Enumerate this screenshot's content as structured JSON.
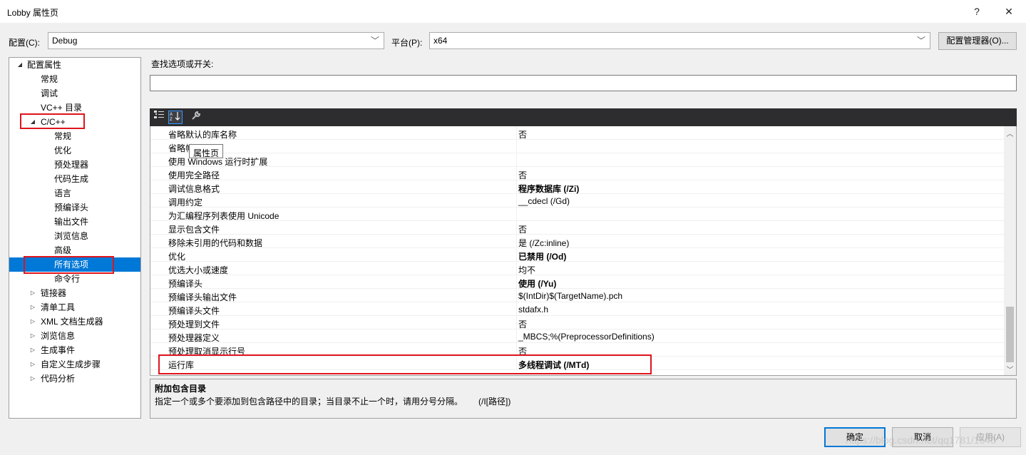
{
  "window": {
    "title": "Lobby 属性页",
    "help_label": "?",
    "close_label": "✕"
  },
  "config": {
    "label": "配置(C):",
    "value": "Debug",
    "platform_label": "平台(P):",
    "platform_value": "x64",
    "manager_button": "配置管理器(O)..."
  },
  "tree": {
    "items": [
      {
        "label": "配置属性",
        "expander": "◢"
      },
      {
        "label": "常规",
        "expander": ""
      },
      {
        "label": "调试",
        "expander": ""
      },
      {
        "label": "VC++ 目录",
        "expander": ""
      },
      {
        "label": "C/C++",
        "expander": "◢"
      },
      {
        "label": "常规",
        "expander": ""
      },
      {
        "label": "优化",
        "expander": ""
      },
      {
        "label": "预处理器",
        "expander": ""
      },
      {
        "label": "代码生成",
        "expander": ""
      },
      {
        "label": "语言",
        "expander": ""
      },
      {
        "label": "预编译头",
        "expander": ""
      },
      {
        "label": "输出文件",
        "expander": ""
      },
      {
        "label": "浏览信息",
        "expander": ""
      },
      {
        "label": "高级",
        "expander": ""
      },
      {
        "label": "所有选项",
        "expander": ""
      },
      {
        "label": "命令行",
        "expander": ""
      },
      {
        "label": "链接器",
        "expander": "▷"
      },
      {
        "label": "清单工具",
        "expander": "▷"
      },
      {
        "label": "XML 文档生成器",
        "expander": "▷"
      },
      {
        "label": "浏览信息",
        "expander": "▷"
      },
      {
        "label": "生成事件",
        "expander": "▷"
      },
      {
        "label": "自定义生成步骤",
        "expander": "▷"
      },
      {
        "label": "代码分析",
        "expander": "▷"
      }
    ]
  },
  "search": {
    "label": "查找选项或开关:",
    "value": ""
  },
  "toolbar": {
    "categorized_icon": "categorized-icon",
    "alphabetical_icon": "alphabetical-icon",
    "property_pages_icon": "wrench-icon"
  },
  "tooltip": "属性页",
  "properties": [
    {
      "name": "省略默认的库名称",
      "value": "否",
      "bold": false
    },
    {
      "name": "省略帧",
      "value": "",
      "bold": false
    },
    {
      "name": "使用 Windows 运行时扩展",
      "value": "",
      "bold": false
    },
    {
      "name": "使用完全路径",
      "value": "否",
      "bold": false
    },
    {
      "name": "调试信息格式",
      "value": "程序数据库 (/Zi)",
      "bold": true
    },
    {
      "name": "调用约定",
      "value": "__cdecl (/Gd)",
      "bold": false
    },
    {
      "name": "为汇编程序列表使用 Unicode",
      "value": "",
      "bold": false
    },
    {
      "name": "显示包含文件",
      "value": "否",
      "bold": false
    },
    {
      "name": "移除未引用的代码和数据",
      "value": "是 (/Zc:inline)",
      "bold": false
    },
    {
      "name": "优化",
      "value": "已禁用 (/Od)",
      "bold": true
    },
    {
      "name": "优选大小或速度",
      "value": "均不",
      "bold": false
    },
    {
      "name": "预编译头",
      "value": "使用 (/Yu)",
      "bold": true
    },
    {
      "name": "预编译头输出文件",
      "value": "$(IntDir)$(TargetName).pch",
      "bold": false
    },
    {
      "name": "预编译头文件",
      "value": "stdafx.h",
      "bold": false
    },
    {
      "name": "预处理到文件",
      "value": "否",
      "bold": false
    },
    {
      "name": "预处理器定义",
      "value": "_MBCS;%(PreprocessorDefinitions)",
      "bold": false
    },
    {
      "name": "预处理取消显示行号",
      "value": "否",
      "bold": false
    },
    {
      "name": "运行库",
      "value": "多线程调试 (/MTd)",
      "bold": true
    }
  ],
  "description": {
    "title": "附加包含目录",
    "text": "指定一个或多个要添加到包含路径中的目录；当目录不止一个时，请用分号分隔。",
    "flag": "(/I[路径])"
  },
  "buttons": {
    "ok": "确定",
    "cancel": "取消",
    "apply": "应用(A)"
  },
  "watermark": "https://blog.csdn.net/qq1781/1640",
  "colors": {
    "selection": "#0078d7",
    "highlight_box": "#e0141e",
    "toolbar_bg": "#2d2d30"
  }
}
